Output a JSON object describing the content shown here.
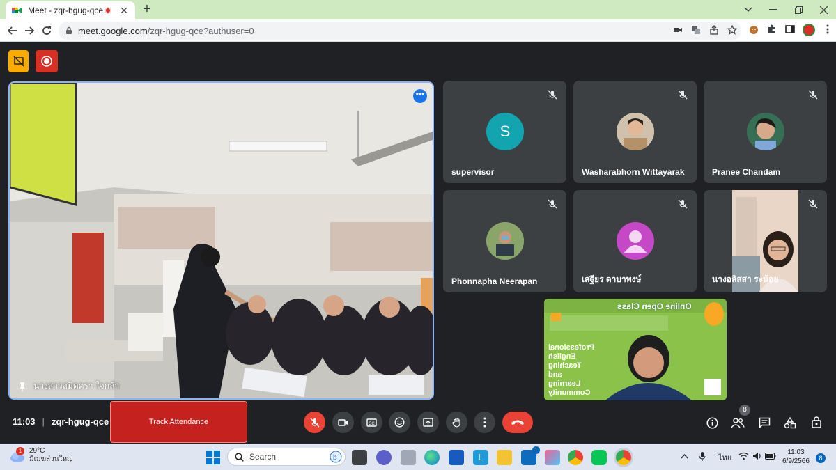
{
  "browser": {
    "tab_title": "Meet - zqr-hgug-qce",
    "tab_close": "✕",
    "new_tab": "+",
    "url_host": "meet.google.com",
    "url_path": "/zqr-hgug-qce?authuser=0"
  },
  "meet": {
    "main_participant": "นางสาวสมิดตรา ใจกล้า",
    "participants": [
      {
        "name": "supervisor",
        "initial": "S",
        "color": "#12a4af"
      },
      {
        "name": "Washarabhorn Wittayarak"
      },
      {
        "name": "Pranee Chandam"
      },
      {
        "name": "Phonnapha Neerapan"
      },
      {
        "name": "เสฐียร ดาบาพงษ์",
        "color": "#c549c7"
      },
      {
        "name": "นางอลิสสา ระน้อย"
      }
    ],
    "self_view": {
      "title": "Online Open Class",
      "words": [
        "Professional",
        "English",
        "Teaching",
        "and",
        "Learning",
        "Community"
      ]
    },
    "people_count": "8",
    "time": "11:03",
    "meeting_code": "zqr-hgug-qce",
    "track_attendance": "Track Attendance",
    "colors": {
      "accent": "#8ab4f8",
      "danger": "#ea4335",
      "tile": "#3c4043",
      "bg": "#202124"
    }
  },
  "taskbar": {
    "temperature": "29°C",
    "weather_text": "มีเมฆส่วนใหญ่",
    "weather_badge": "1",
    "search_label": "Search",
    "mail_badge": "1",
    "lang": "ไทย",
    "clock_time": "11:03",
    "clock_date": "6/9/2566",
    "notifications": "8"
  }
}
